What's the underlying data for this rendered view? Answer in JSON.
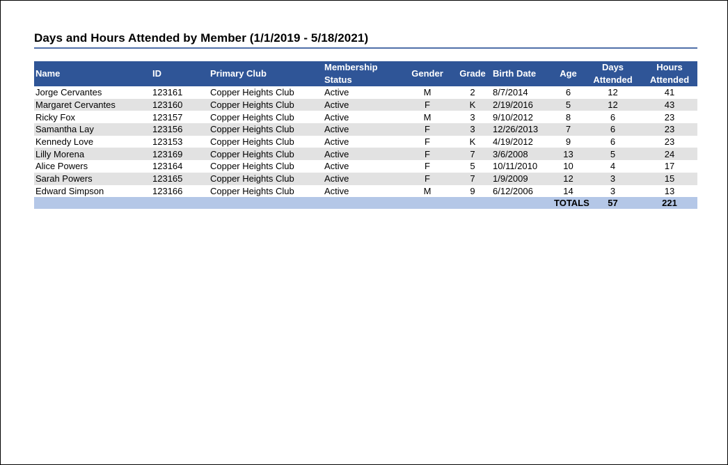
{
  "report": {
    "title": "Days and Hours Attended by Member (1/1/2019 - 5/18/2021)"
  },
  "table": {
    "headers": {
      "name": "Name",
      "id": "ID",
      "club": "Primary Club",
      "status_line1": "Membership",
      "status_line2": "Status",
      "gender": "Gender",
      "grade": "Grade",
      "birth": "Birth Date",
      "age": "Age",
      "days_line1": "Days",
      "days_line2": "Attended",
      "hours_line1": "Hours",
      "hours_line2": "Attended"
    },
    "rows": [
      {
        "name": "Jorge Cervantes",
        "id": "123161",
        "club": "Copper Heights Club",
        "status": "Active",
        "gender": "M",
        "grade": "2",
        "birth": "8/7/2014",
        "age": "6",
        "days": "12",
        "hours": "41"
      },
      {
        "name": "Margaret Cervantes",
        "id": "123160",
        "club": "Copper Heights Club",
        "status": "Active",
        "gender": "F",
        "grade": "K",
        "birth": "2/19/2016",
        "age": "5",
        "days": "12",
        "hours": "43"
      },
      {
        "name": "Ricky Fox",
        "id": "123157",
        "club": "Copper Heights Club",
        "status": "Active",
        "gender": "M",
        "grade": "3",
        "birth": "9/10/2012",
        "age": "8",
        "days": "6",
        "hours": "23"
      },
      {
        "name": "Samantha Lay",
        "id": "123156",
        "club": "Copper Heights Club",
        "status": "Active",
        "gender": "F",
        "grade": "3",
        "birth": "12/26/2013",
        "age": "7",
        "days": "6",
        "hours": "23"
      },
      {
        "name": "Kennedy Love",
        "id": "123153",
        "club": "Copper Heights Club",
        "status": "Active",
        "gender": "F",
        "grade": "K",
        "birth": "4/19/2012",
        "age": "9",
        "days": "6",
        "hours": "23"
      },
      {
        "name": "Lilly Morena",
        "id": "123169",
        "club": "Copper Heights Club",
        "status": "Active",
        "gender": "F",
        "grade": "7",
        "birth": "3/6/2008",
        "age": "13",
        "days": "5",
        "hours": "24"
      },
      {
        "name": "Alice Powers",
        "id": "123164",
        "club": "Copper Heights Club",
        "status": "Active",
        "gender": "F",
        "grade": "5",
        "birth": "10/11/2010",
        "age": "10",
        "days": "4",
        "hours": "17"
      },
      {
        "name": "Sarah Powers",
        "id": "123165",
        "club": "Copper Heights Club",
        "status": "Active",
        "gender": "F",
        "grade": "7",
        "birth": "1/9/2009",
        "age": "12",
        "days": "3",
        "hours": "15"
      },
      {
        "name": "Edward Simpson",
        "id": "123166",
        "club": "Copper Heights Club",
        "status": "Active",
        "gender": "M",
        "grade": "9",
        "birth": "6/12/2006",
        "age": "14",
        "days": "3",
        "hours": "13"
      }
    ],
    "totals": {
      "label": "TOTALS",
      "days": "57",
      "hours": "221"
    }
  },
  "colors": {
    "header_bg": "#2f5597",
    "band_bg": "#e2e2e2",
    "totals_bg": "#b4c7e7",
    "rule": "#4f6fa8"
  }
}
